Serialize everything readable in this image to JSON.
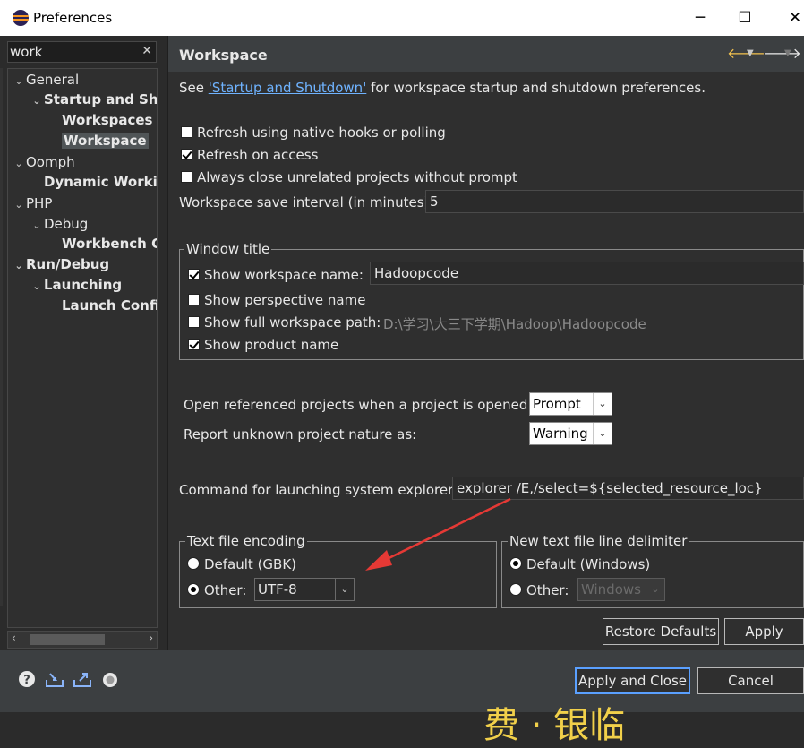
{
  "window": {
    "title": "Preferences",
    "minimize": "─",
    "maximize": "☐",
    "close": "✕"
  },
  "filter": {
    "value": "work",
    "clear": "✕"
  },
  "tree": [
    {
      "label": "General",
      "tw": "⌄",
      "bold": false,
      "selected": false
    },
    {
      "label": "Startup and Shu",
      "tw": "⌄",
      "bold": true,
      "selected": false
    },
    {
      "label": "Workspaces",
      "tw": "",
      "bold": true,
      "selected": false
    },
    {
      "label": "Workspace",
      "tw": "",
      "bold": true,
      "selected": true
    },
    {
      "label": "Oomph",
      "tw": "⌄",
      "bold": false,
      "selected": false
    },
    {
      "label": "Dynamic Workin",
      "tw": "",
      "bold": true,
      "selected": false
    },
    {
      "label": "PHP",
      "tw": "⌄",
      "bold": false,
      "selected": false
    },
    {
      "label": "Debug",
      "tw": "⌄",
      "bold": false,
      "selected": false
    },
    {
      "label": "Workbench O",
      "tw": "",
      "bold": true,
      "selected": false
    },
    {
      "label": "Run/Debug",
      "tw": "⌄",
      "bold": true,
      "selected": false
    },
    {
      "label": "Launching",
      "tw": "⌄",
      "bold": true,
      "selected": false
    },
    {
      "label": "Launch Config",
      "tw": "",
      "bold": true,
      "selected": false
    }
  ],
  "header": {
    "title": "Workspace"
  },
  "page": {
    "see_prefix": "See ",
    "see_link": "'Startup and Shutdown'",
    "see_suffix": " for workspace startup and shutdown preferences.",
    "refresh_native": "Refresh using native hooks or polling",
    "refresh_access": "Refresh on access",
    "always_close": "Always close unrelated projects without prompt",
    "save_interval_label": "Workspace save interval (in minutes):",
    "save_interval_value": "5",
    "window_title": {
      "group_label": "Window title",
      "show_name": "Show workspace name:",
      "workspace_name": "Hadoopcode",
      "show_perspective": "Show perspective name",
      "show_full_path": "Show full workspace path:",
      "full_path": "D:\\学习\\大三下学期\\Hadoop\\Hadoopcode",
      "show_product": "Show product name"
    },
    "open_ref_label": "Open referenced projects when a project is opened:",
    "open_ref_value": "Prompt",
    "report_unknown_label": "Report unknown project nature as:",
    "report_unknown_value": "Warning",
    "command_label": "Command for launching system explorer:",
    "command_value": "explorer /E,/select=${selected_resource_loc}",
    "encoding": {
      "group_label": "Text file encoding",
      "default": "Default (GBK)",
      "other": "Other:",
      "other_value": "UTF-8"
    },
    "delimiter": {
      "group_label": "New text file line delimiter",
      "default": "Default (Windows)",
      "other": "Other:",
      "other_value": "Windows"
    },
    "restore_defaults": "Restore Defaults",
    "apply": "Apply"
  },
  "footer": {
    "apply_close": "Apply and Close",
    "cancel": "Cancel",
    "icons": [
      "help-icon",
      "import-icon",
      "export-icon",
      "record-icon"
    ]
  },
  "colors": {
    "accent": "#5aa0ff",
    "link": "#6fb3ff",
    "arrow": "#e53935",
    "overlay_text": "#f1d04a"
  }
}
